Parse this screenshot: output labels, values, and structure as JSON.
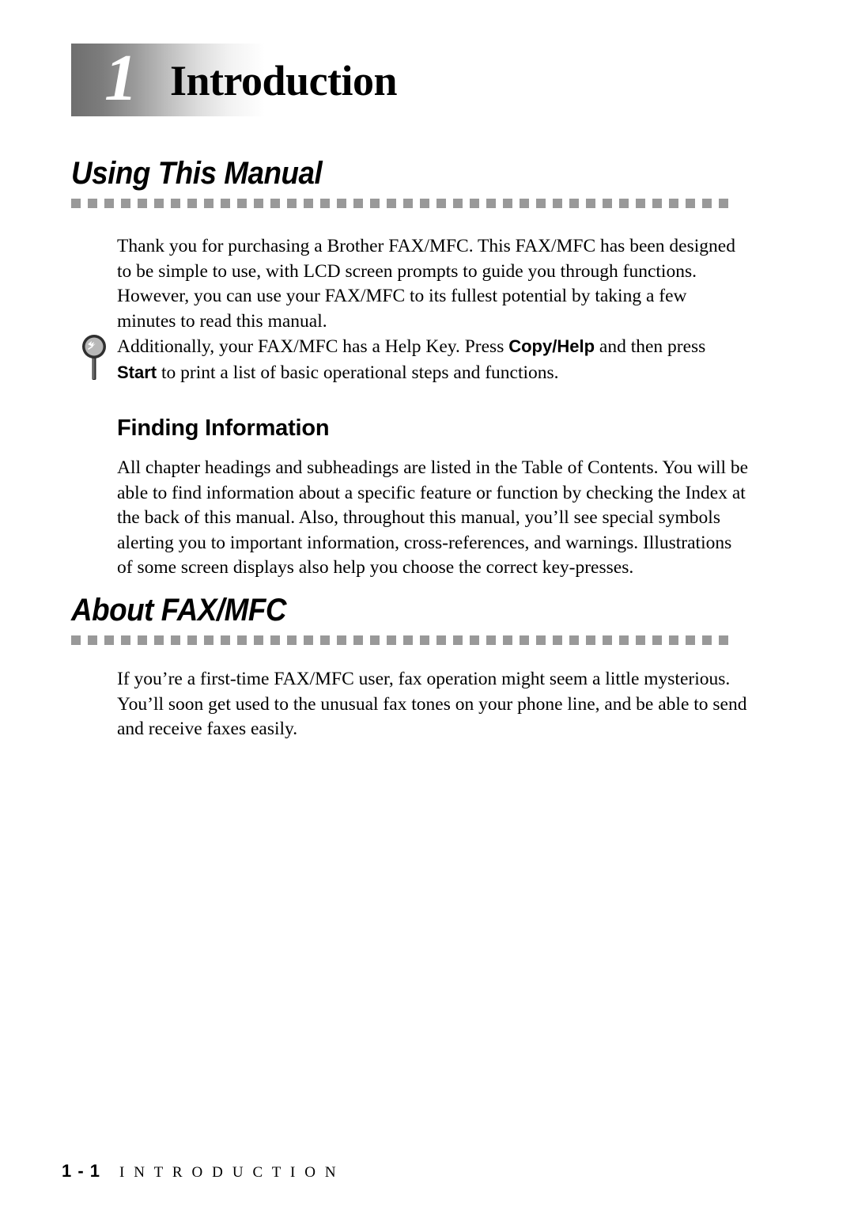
{
  "page": {
    "chapter_number": "1",
    "chapter_title": "Introduction"
  },
  "sections": [
    {
      "title": "Using This Manual",
      "paragraphs": [
        "Thank you for purchasing a Brother FAX/MFC. This FAX/MFC has been designed to be simple to use, with LCD screen prompts to guide you through functions. However, you can use your FAX/MFC to its fullest potential by taking a few minutes to read this manual."
      ],
      "note": {
        "icon": "magnifier-icon",
        "text_before_first_key": "Additionally, your FAX/MFC has a Help Key. Press ",
        "key_one": "Copy/Help",
        "text_between_keys": " and then press ",
        "key_two": "Start",
        "text_after_second_key": " to print a list of basic operational steps and functions."
      },
      "subheading": "Finding Information",
      "subheading_paragraph": "All chapter headings and subheadings are listed in the Table of Contents. You will be able to find information about a specific feature or function by checking the Index at the back of this manual. Also, throughout this manual, you’ll see special symbols alerting you to important information, cross-references, and warnings. Illustrations of some screen displays also help you choose the correct key-presses."
    },
    {
      "title": "About FAX/MFC",
      "paragraphs": [
        "If you’re a first-time FAX/MFC user, fax operation might seem a little mysterious. You’ll soon get used to the unusual fax tones on your phone line, and be able to send and receive faxes easily."
      ]
    }
  ],
  "footer": {
    "page_number": "1 - 1",
    "chapter_name": "I N T R O D U C T I O N"
  },
  "colors": {
    "text": "#000000",
    "dash_rule": "#999999",
    "header_gradient_start": "#6e6e6e",
    "header_gradient_end": "#ffffff",
    "icon_ring": "#3a3a3a",
    "icon_lens": "#b5b5b5"
  }
}
